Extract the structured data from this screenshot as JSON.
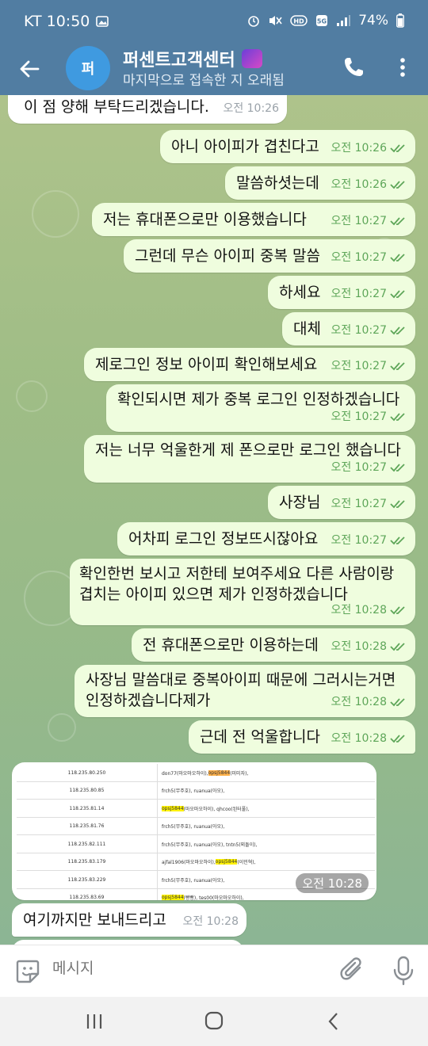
{
  "status_bar": {
    "carrier_time": "KT 10:50",
    "battery": "74%",
    "icons": [
      "image-icon",
      "alarm-icon",
      "mute-icon",
      "hd-icon",
      "5g-icon",
      "signal-icon",
      "battery-icon"
    ]
  },
  "header": {
    "avatar_text": "퍼",
    "title": "퍼센트고객센터",
    "title_emoji": "badge-emoji",
    "subtitle": "마지막으로 접속한 지 오래됨",
    "accent_color": "#517da2"
  },
  "messages": [
    {
      "text": "이 점 양해 부탁드리겠습니다.",
      "time": "오전 10:26",
      "dir": "in"
    },
    {
      "text": "아니 아이피가 겹친다고",
      "time": "오전 10:26",
      "dir": "out"
    },
    {
      "text": "말씀하셧는데",
      "time": "오전 10:26",
      "dir": "out"
    },
    {
      "text": "저는 휴대폰으로만 이용했습니다",
      "time": "오전 10:27",
      "dir": "out"
    },
    {
      "text": "그런데 무슨 아이피 중복 말씀",
      "time": "오전 10:27",
      "dir": "out"
    },
    {
      "text": "하세요",
      "time": "오전 10:27",
      "dir": "out"
    },
    {
      "text": "대체",
      "time": "오전 10:27",
      "dir": "out"
    },
    {
      "text": "제로그인 정보 아이피 확인해보세요",
      "time": "오전 10:27",
      "dir": "out"
    },
    {
      "text": "확인되시면 제가 중복 로그인 인정하겠습니다",
      "time": "오전 10:27",
      "dir": "out"
    },
    {
      "text": "저는 너무 억울한게 제 폰으로만 로그인 했습니다",
      "time": "오전 10:27",
      "dir": "out"
    },
    {
      "text": "사장님",
      "time": "오전 10:27",
      "dir": "out"
    },
    {
      "text": "어차피 로그인 정보뜨시잖아요",
      "time": "오전 10:27",
      "dir": "out"
    },
    {
      "text": "확인한번 보시고 저한테 보여주세요 다른 사람이랑\n겹치는 아이피 있으면 제가 인정하겠습니다",
      "time": "오전 10:28",
      "dir": "out"
    },
    {
      "text": "전 휴대폰으로만 이용하는데",
      "time": "오전 10:28",
      "dir": "out"
    },
    {
      "text": "사장님 말씀대로 중복아이피 때문에 그러시는거면\n인정하겠습니다제가",
      "time": "오전 10:28",
      "dir": "out"
    },
    {
      "text": "근데 전 억울합니다",
      "time": "오전 10:28",
      "dir": "out"
    }
  ],
  "image_message": {
    "time": "오전 10:28",
    "rows": [
      {
        "ip": "118.235.80.250",
        "pre": "don77(마오마오하이), ",
        "hl": "opsj5844",
        "hl_color": "orange",
        "post": "(미미자),"
      },
      {
        "ip": "118.235.80.85",
        "pre": "frch5(무주호), ruanua(아오),",
        "hl": "",
        "hl_color": "",
        "post": ""
      },
      {
        "ip": "118.235.81.14",
        "pre": "",
        "hl": "opsj5844",
        "hl_color": "yellow",
        "post": "(마오마오하이), qhcoo(된터풀),"
      },
      {
        "ip": "118.235.81.76",
        "pre": "frch5(무주호), ruanua(아오),",
        "hl": "",
        "hl_color": "",
        "post": ""
      },
      {
        "ip": "118.235.82.111",
        "pre": "frch5(무주호), ruanua(아오), tntn5(뫼돌이),",
        "hl": "",
        "hl_color": "",
        "post": ""
      },
      {
        "ip": "118.235.83.179",
        "pre": "ajfal1906(마오마오하이), ",
        "hl": "opsj5844",
        "hl_color": "yellow",
        "post": "(이민혁),"
      },
      {
        "ip": "118.235.83.229",
        "pre": "frch5(무주호), ruanua(아오),",
        "hl": "",
        "hl_color": "",
        "post": ""
      },
      {
        "ip": "118.235.83.69",
        "pre": "",
        "hl": "opsj5844",
        "hl_color": "yellow",
        "post": "(빵빵), tes00(마오마오하이),"
      }
    ]
  },
  "last_message": {
    "text": "여기까지만 보내드리고",
    "time": "오전 10:28",
    "dir": "in"
  },
  "input": {
    "placeholder": "메시지"
  },
  "colors": {
    "outgoing_bubble": "#effdde",
    "incoming_bubble": "#ffffff",
    "time_out": "#5ea659",
    "chat_bg": "#a5bf88"
  }
}
